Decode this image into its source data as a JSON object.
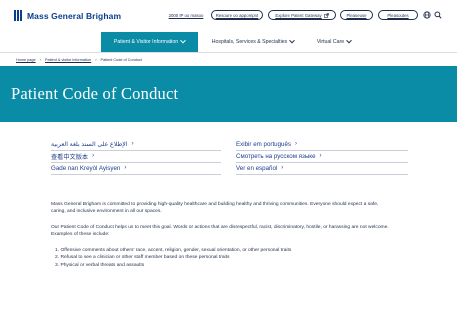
{
  "brand": {
    "name": "Mass General Brigham"
  },
  "utility_links": [
    {
      "label": "2000 IP oo masoo",
      "style": "link"
    },
    {
      "label": "Resoure oo appompnt",
      "style": "pill"
    },
    {
      "label": "Explore Patent Gateway",
      "style": "pill"
    },
    {
      "label": "Pleaseuse",
      "style": "pill"
    },
    {
      "label": "Pleasoutes",
      "style": "pill"
    }
  ],
  "nav": {
    "items": [
      {
        "label": "Patient & Visitor Information"
      },
      {
        "label": "Hospitals, Services & Specialties"
      },
      {
        "label": "Virtual Care"
      }
    ]
  },
  "breadcrumb": {
    "items": [
      "Home page",
      "Patient & visitor information",
      "Patient Code of Conduct"
    ]
  },
  "page": {
    "title": "Patient Code of Conduct"
  },
  "languages": {
    "left": [
      "الإطلاع على السند بلغة العربية",
      "查看中文版本",
      "Gade nan Kreyòl Ayisyen"
    ],
    "right": [
      "Exibir em português",
      "Смотреть на русском языке",
      "Ver en español"
    ]
  },
  "content": {
    "paragraph_1": "Mass General Brigham is committed to providing high-quality healthcare and building healthy and thriving communities. Everyone should expect a safe, caring, and inclusive environment in all our spaces.",
    "paragraph_2": "Our Patient Code of Conduct helps us to meet this goal. Words or actions that are disrespectful, racist, discriminatory, hostile, or harassing are not welcome. Examples of these include:",
    "list": [
      "1. Offensive comments about others' race, accent, religion, gender, sexual orientation, or other personal traits",
      "2. Refusal to see a clinician or other staff member based on these personal traits",
      "3. Physical or verbal threats and assaults"
    ]
  },
  "colors": {
    "brand_blue": "#0a3d8f",
    "teal": "#0a8ba6",
    "link": "#1f3f8a"
  }
}
